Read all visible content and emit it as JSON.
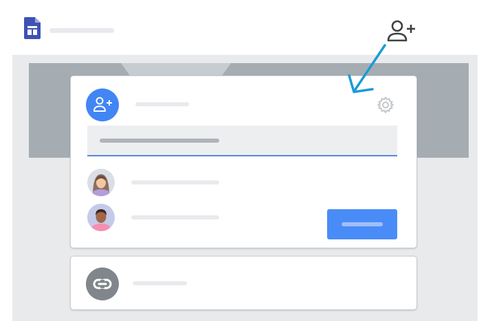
{
  "app": {
    "icon": "google-sites-doc-icon",
    "title": ""
  },
  "toolbar": {
    "share_icon": "person-add-icon"
  },
  "annotation": {
    "arrow_color": "#1a9bd7"
  },
  "share_dialog": {
    "header_icon": "person-add-icon",
    "title": "",
    "settings_icon": "gear-icon",
    "input": {
      "placeholder": "",
      "value": ""
    },
    "people": [
      {
        "avatar": "woman-avatar",
        "name": ""
      },
      {
        "avatar": "man-avatar",
        "name": ""
      }
    ],
    "send_button_label": "",
    "accent_color": "#4285f4"
  },
  "link_card": {
    "icon": "link-icon",
    "label": ""
  }
}
